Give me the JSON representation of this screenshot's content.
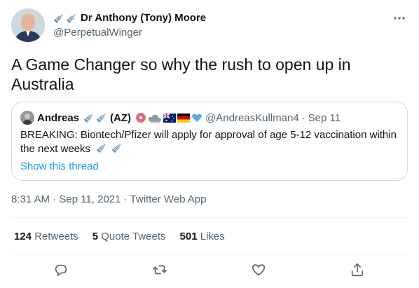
{
  "author": {
    "display_name": "Dr Anthony (Tony) Moore",
    "handle": "@PerpetualWinger"
  },
  "tweet": {
    "text": "A Game Changer so why the rush to open up in Australia",
    "timestamp": "8:31 AM · Sep 11, 2021 · Twitter Web App"
  },
  "quoted": {
    "name": "Andreas",
    "name_suffix": "(AZ)",
    "handle": "@AndreasKullman4",
    "separator": "·",
    "date": "Sep 11",
    "text": "BREAKING: Biontech/Pfizer will apply for approval of age 5-12 vaccination within the next weeks",
    "link": "Show this thread"
  },
  "stats": {
    "retweets_count": "124",
    "retweets_label": "Retweets",
    "quotes_count": "5",
    "quotes_label": "Quote Tweets",
    "likes_count": "501",
    "likes_label": "Likes"
  },
  "icons": {
    "more": "more-horizontal-icon",
    "reply": "reply-icon",
    "retweet": "retweet-icon",
    "like": "heart-icon",
    "share": "share-icon",
    "syringe": "syringe-icon"
  },
  "colors": {
    "text": "#0f1419",
    "secondary": "#536471",
    "link": "#1d9bf0",
    "border": "#cfd9de"
  }
}
